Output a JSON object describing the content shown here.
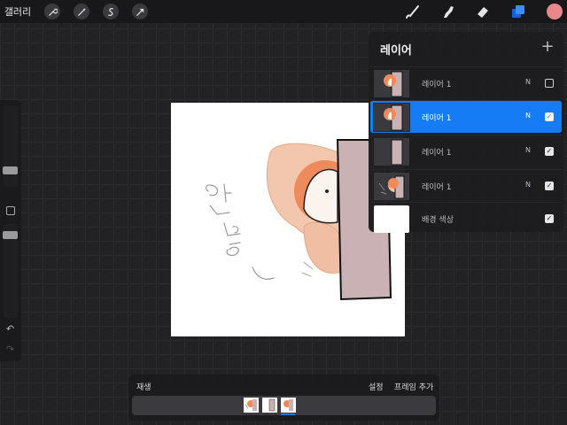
{
  "topbar": {
    "gallery_label": "갤러리",
    "left_tools": [
      "wrench-icon",
      "magic-wand-icon",
      "selection-icon",
      "transform-arrow-icon"
    ],
    "right_tools": [
      "brush-icon",
      "smudge-icon",
      "eraser-icon",
      "layers-icon"
    ],
    "current_color": "#e8888a"
  },
  "layers_panel": {
    "title": "레이어",
    "add_symbol": "+",
    "layers": [
      {
        "name": "레이어 1",
        "blend": "N",
        "visible": false,
        "selected": false
      },
      {
        "name": "레이어 1",
        "blend": "N",
        "visible": true,
        "selected": true
      },
      {
        "name": "레이어 1",
        "blend": "N",
        "visible": true,
        "selected": false
      },
      {
        "name": "레이어 1",
        "blend": "N",
        "visible": true,
        "selected": false
      }
    ],
    "background": {
      "name": "배경 색상",
      "visible": true
    }
  },
  "animation": {
    "play_label": "재생",
    "settings_label": "설정",
    "add_frame_label": "프레임 추가",
    "frame_count": 3,
    "current_frame": 3
  },
  "canvas": {
    "handwriting": "안녕~"
  },
  "colors": {
    "accent": "#157cf5",
    "panel": "#1e1e21",
    "background": "#222225"
  },
  "check_symbol": "✓",
  "undo_symbol": "↶",
  "redo_symbol": "↷"
}
